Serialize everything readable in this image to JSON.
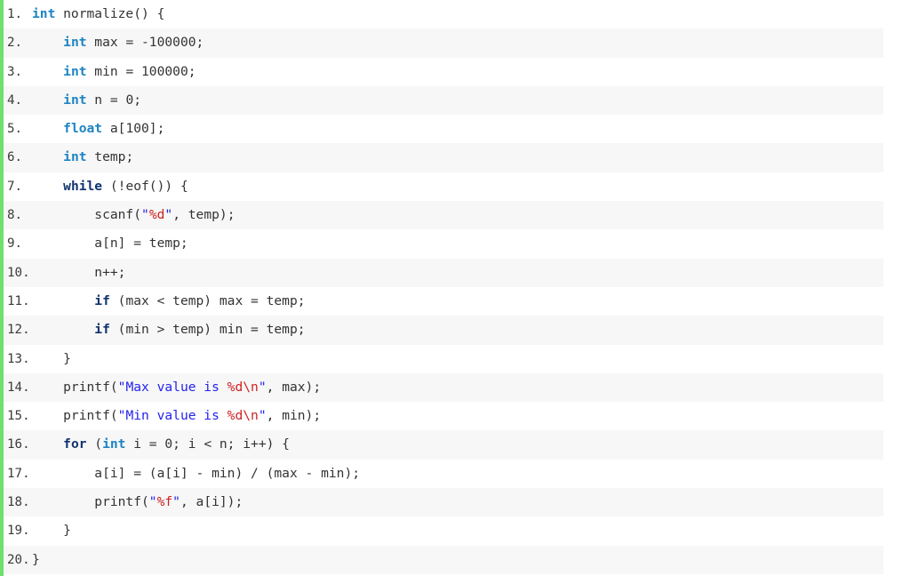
{
  "accent_color": "#6ee06e",
  "row_alt_color": "#f7f7f7",
  "row_color": "#ffffff",
  "colors": {
    "type_keyword": "#1d84c3",
    "control_keyword": "#11336e",
    "string": "#2323ee",
    "format_specifier": "#d02020",
    "plain": "#333333"
  },
  "language": "c",
  "lines": [
    {
      "number": "1.",
      "tokens": [
        {
          "t": "type",
          "v": "int"
        },
        {
          "t": "plain",
          "v": " normalize() {"
        }
      ]
    },
    {
      "number": "2.",
      "tokens": [
        {
          "t": "plain",
          "v": "    "
        },
        {
          "t": "type",
          "v": "int"
        },
        {
          "t": "plain",
          "v": " max = -100000;"
        }
      ]
    },
    {
      "number": "3.",
      "tokens": [
        {
          "t": "plain",
          "v": "    "
        },
        {
          "t": "type",
          "v": "int"
        },
        {
          "t": "plain",
          "v": " min = 100000;"
        }
      ]
    },
    {
      "number": "4.",
      "tokens": [
        {
          "t": "plain",
          "v": "    "
        },
        {
          "t": "type",
          "v": "int"
        },
        {
          "t": "plain",
          "v": " n = 0;"
        }
      ]
    },
    {
      "number": "5.",
      "tokens": [
        {
          "t": "plain",
          "v": "    "
        },
        {
          "t": "type",
          "v": "float"
        },
        {
          "t": "plain",
          "v": " a[100];"
        }
      ]
    },
    {
      "number": "6.",
      "tokens": [
        {
          "t": "plain",
          "v": "    "
        },
        {
          "t": "type",
          "v": "int"
        },
        {
          "t": "plain",
          "v": " temp;"
        }
      ]
    },
    {
      "number": "7.",
      "tokens": [
        {
          "t": "plain",
          "v": "    "
        },
        {
          "t": "keyword",
          "v": "while"
        },
        {
          "t": "plain",
          "v": " (!eof()) {"
        }
      ]
    },
    {
      "number": "8.",
      "tokens": [
        {
          "t": "plain",
          "v": "        scanf("
        },
        {
          "t": "string",
          "v": "\""
        },
        {
          "t": "fmt",
          "v": "%d"
        },
        {
          "t": "string",
          "v": "\""
        },
        {
          "t": "plain",
          "v": ", temp);"
        }
      ]
    },
    {
      "number": "9.",
      "tokens": [
        {
          "t": "plain",
          "v": "        a[n] = temp;"
        }
      ]
    },
    {
      "number": "10.",
      "tokens": [
        {
          "t": "plain",
          "v": "        n++;"
        }
      ]
    },
    {
      "number": "11.",
      "tokens": [
        {
          "t": "plain",
          "v": "        "
        },
        {
          "t": "keyword",
          "v": "if"
        },
        {
          "t": "plain",
          "v": " (max < temp) max = temp;"
        }
      ]
    },
    {
      "number": "12.",
      "tokens": [
        {
          "t": "plain",
          "v": "        "
        },
        {
          "t": "keyword",
          "v": "if"
        },
        {
          "t": "plain",
          "v": " (min > temp) min = temp;"
        }
      ]
    },
    {
      "number": "13.",
      "tokens": [
        {
          "t": "plain",
          "v": "    }"
        }
      ]
    },
    {
      "number": "14.",
      "tokens": [
        {
          "t": "plain",
          "v": "    printf("
        },
        {
          "t": "string",
          "v": "\"Max value is "
        },
        {
          "t": "fmt",
          "v": "%d\\n"
        },
        {
          "t": "string",
          "v": "\""
        },
        {
          "t": "plain",
          "v": ", max);"
        }
      ]
    },
    {
      "number": "15.",
      "tokens": [
        {
          "t": "plain",
          "v": "    printf("
        },
        {
          "t": "string",
          "v": "\"Min value is "
        },
        {
          "t": "fmt",
          "v": "%d\\n"
        },
        {
          "t": "string",
          "v": "\""
        },
        {
          "t": "plain",
          "v": ", min);"
        }
      ]
    },
    {
      "number": "16.",
      "tokens": [
        {
          "t": "plain",
          "v": "    "
        },
        {
          "t": "keyword",
          "v": "for"
        },
        {
          "t": "plain",
          "v": " ("
        },
        {
          "t": "type",
          "v": "int"
        },
        {
          "t": "plain",
          "v": " i = 0; i < n; i++) {"
        }
      ]
    },
    {
      "number": "17.",
      "tokens": [
        {
          "t": "plain",
          "v": "        a[i] = (a[i] - min) / (max - min);"
        }
      ]
    },
    {
      "number": "18.",
      "tokens": [
        {
          "t": "plain",
          "v": "        printf("
        },
        {
          "t": "string",
          "v": "\""
        },
        {
          "t": "fmt",
          "v": "%f"
        },
        {
          "t": "string",
          "v": "\""
        },
        {
          "t": "plain",
          "v": ", a[i]);"
        }
      ]
    },
    {
      "number": "19.",
      "tokens": [
        {
          "t": "plain",
          "v": "    }"
        }
      ]
    },
    {
      "number": "20.",
      "tokens": [
        {
          "t": "plain",
          "v": "}"
        }
      ]
    }
  ]
}
